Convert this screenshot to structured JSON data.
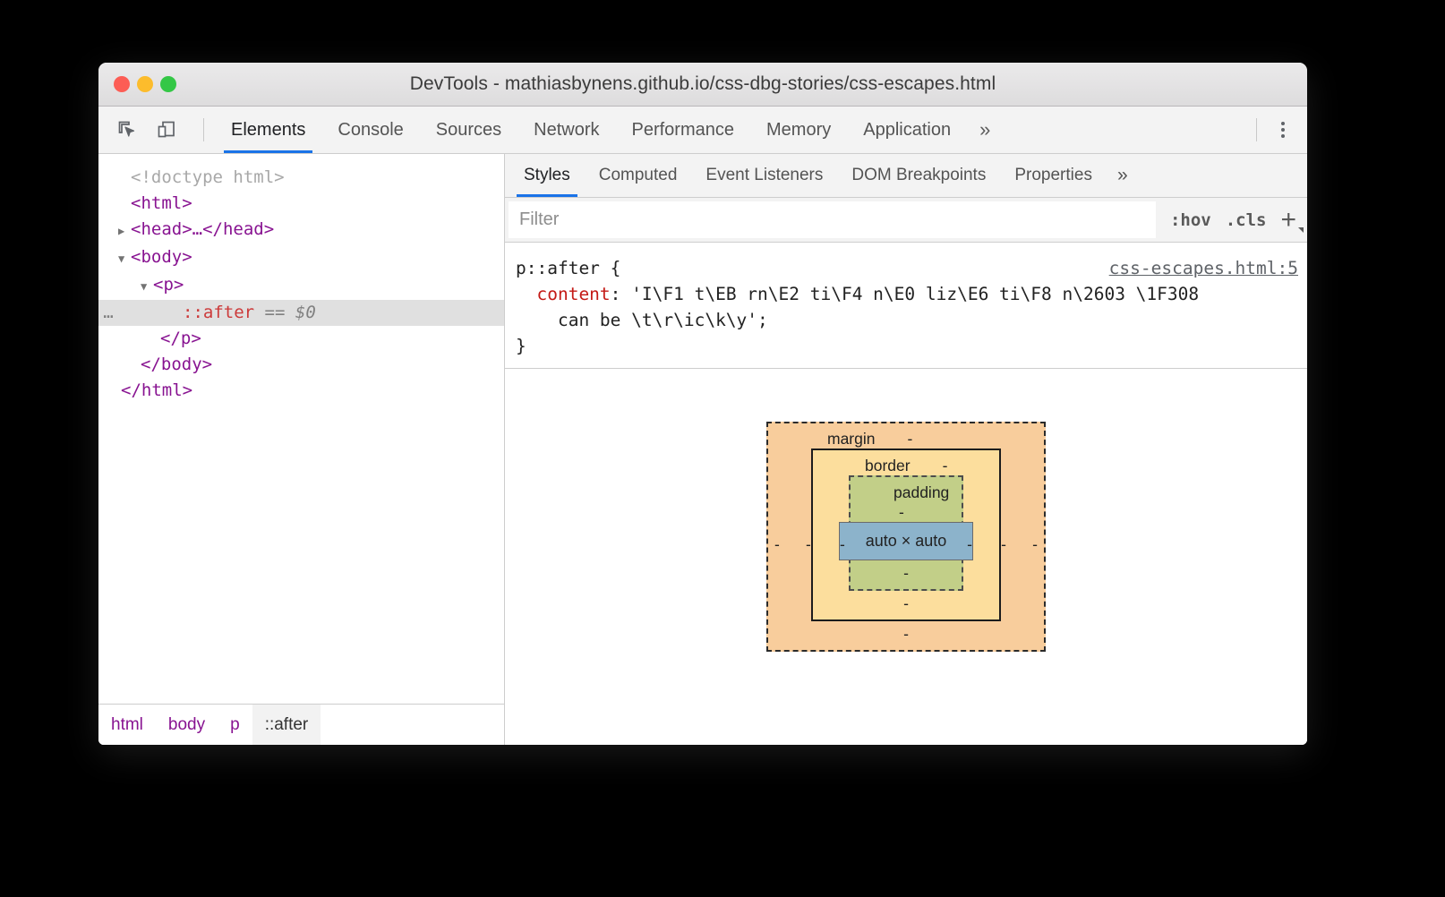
{
  "window": {
    "title": "DevTools - mathiasbynens.github.io/css-dbg-stories/css-escapes.html",
    "traffic_lights": [
      "close",
      "minimize",
      "zoom"
    ]
  },
  "toolbar": {
    "icons": [
      {
        "name": "inspect-element-icon"
      },
      {
        "name": "device-toolbar-icon"
      }
    ],
    "tabs": [
      {
        "label": "Elements",
        "active": true
      },
      {
        "label": "Console",
        "active": false
      },
      {
        "label": "Sources",
        "active": false
      },
      {
        "label": "Network",
        "active": false
      },
      {
        "label": "Performance",
        "active": false
      },
      {
        "label": "Memory",
        "active": false
      },
      {
        "label": "Application",
        "active": false
      }
    ],
    "more_label": "»",
    "menu_label": "more-options"
  },
  "dom_tree": {
    "rows": [
      {
        "indent": 0,
        "twisty": "",
        "text": "<!doctype html>",
        "kind": "doctype"
      },
      {
        "indent": 0,
        "twisty": "",
        "text": "<html>",
        "kind": "tag"
      },
      {
        "indent": 0,
        "twisty": "▶",
        "text": "<head>…</head>",
        "kind": "tag"
      },
      {
        "indent": 0,
        "twisty": "▼",
        "text": "<body>",
        "kind": "tag"
      },
      {
        "indent": 1,
        "twisty": "▼",
        "text": "<p>",
        "kind": "tag"
      },
      {
        "indent": 2,
        "twisty": "",
        "text": "::after",
        "kind": "pseudo",
        "suffix_eq": "==",
        "suffix_var": "$0",
        "selected": true,
        "ellipsis": "…"
      },
      {
        "indent": 1,
        "twisty": "",
        "text": "</p>",
        "kind": "tag"
      },
      {
        "indent": 0,
        "twisty": "",
        "text": "</body>",
        "kind": "tag"
      },
      {
        "indent": 0,
        "twisty": "",
        "text": "</html>",
        "kind": "tag"
      }
    ]
  },
  "breadcrumbs": [
    {
      "label": "html",
      "selected": false
    },
    {
      "label": "body",
      "selected": false
    },
    {
      "label": "p",
      "selected": false
    },
    {
      "label": "::after",
      "selected": true
    }
  ],
  "sidebar": {
    "tabs": [
      {
        "label": "Styles",
        "active": true
      },
      {
        "label": "Computed",
        "active": false
      },
      {
        "label": "Event Listeners",
        "active": false
      },
      {
        "label": "DOM Breakpoints",
        "active": false
      },
      {
        "label": "Properties",
        "active": false
      }
    ],
    "more_label": "»",
    "filter": {
      "placeholder": "Filter",
      "value": ""
    },
    "actions": {
      "hov_label": ":hov",
      "cls_label": ".cls",
      "new_rule_label": "+"
    }
  },
  "css_rule": {
    "selector": "p::after {",
    "source_link": "css-escapes.html:5",
    "property_name": "content",
    "property_value_line1": "'I\\F1 t\\EB rn\\E2 ti\\F4 n\\E0 liz\\E6 ti\\F8 n\\2603 \\1F308",
    "property_value_line2": "can be \\t\\r\\ic\\k\\y';",
    "close_brace": "}"
  },
  "box_model": {
    "margin_label": "margin",
    "margin_values": {
      "top": "-",
      "right": "-",
      "bottom": "-",
      "left": "-"
    },
    "border_label": "border",
    "border_values": {
      "top": "-",
      "right": "-",
      "bottom": "-",
      "left": "-"
    },
    "padding_label": "padding",
    "padding_values": {
      "top": "-",
      "right": "-",
      "bottom": "-",
      "left": "-"
    },
    "content_label": "auto × auto",
    "colors": {
      "margin": "#f8cd9c",
      "border": "#fcde9d",
      "padding": "#c2cf88",
      "content": "#8cb3cb"
    }
  },
  "colors": {
    "accent": "#1a73e8",
    "tag": "#881391",
    "pseudo": "#cc3a3a",
    "property": "#c41a16"
  }
}
